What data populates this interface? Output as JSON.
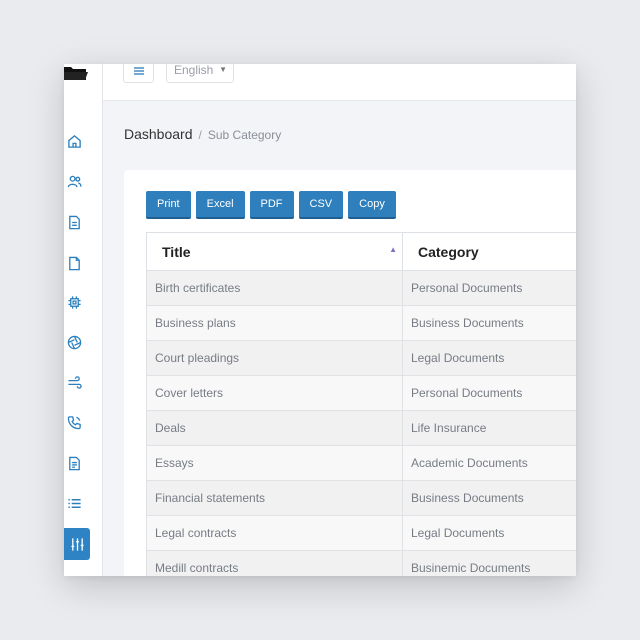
{
  "topbar": {
    "language": "English"
  },
  "breadcrumb": {
    "main": "Dashboard",
    "separator": "/",
    "sub": "Sub Category"
  },
  "toolbar": {
    "print_label": "Print",
    "excel_label": "Excel",
    "pdf_label": "PDF",
    "csv_label": "CSV",
    "copy_label": "Copy"
  },
  "sidebar": {
    "icons": [
      "home-icon",
      "users-icon",
      "document-icon",
      "file-icon",
      "chip-icon",
      "aperture-icon",
      "wind-icon",
      "phone-icon",
      "report-icon",
      "list-icon",
      "sliders-icon"
    ],
    "accent": "#2d83c4"
  },
  "table": {
    "columns": [
      "Title",
      "Category"
    ],
    "rows": [
      [
        "Birth certificates",
        "Personal Documents"
      ],
      [
        "Business plans",
        "Business Documents"
      ],
      [
        "Court pleadings",
        "Legal Documents"
      ],
      [
        "Cover letters",
        "Personal Documents"
      ],
      [
        "Deals",
        "Life Insurance"
      ],
      [
        "Essays",
        "Academic Documents"
      ],
      [
        "Financial statements",
        "Business Documents"
      ],
      [
        "Legal contracts",
        "Legal Documents"
      ],
      [
        "Medill contracts",
        "Businemic Documents"
      ]
    ]
  }
}
